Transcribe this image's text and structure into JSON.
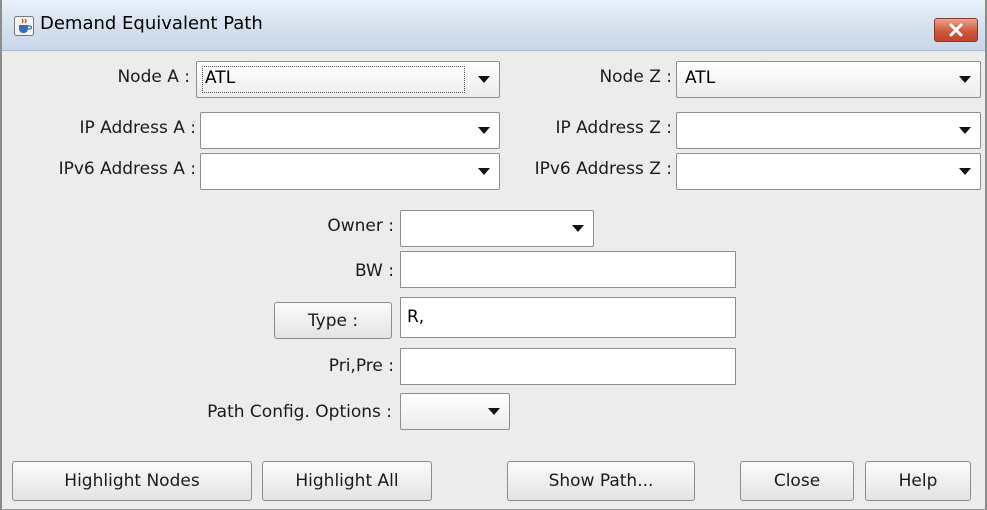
{
  "window": {
    "title": "Demand Equivalent Path",
    "icons": {
      "title": "java-cup-icon",
      "close": "close-icon"
    },
    "colors": {
      "close_button": "#c94a33",
      "titlebar": "#d3dfee",
      "body": "#ececec"
    }
  },
  "fields": {
    "node_a": {
      "label": "Node A :",
      "value": "ATL"
    },
    "node_z": {
      "label": "Node Z :",
      "value": "ATL"
    },
    "ip_a": {
      "label": "IP Address A :",
      "value": ""
    },
    "ip_z": {
      "label": "IP Address Z :",
      "value": ""
    },
    "ipv6_a": {
      "label": "IPv6 Address A :",
      "value": ""
    },
    "ipv6_z": {
      "label": "IPv6 Address Z :",
      "value": ""
    },
    "owner": {
      "label": "Owner :",
      "value": ""
    },
    "bw": {
      "label": "BW :",
      "value": ""
    },
    "type": {
      "label": "Type :",
      "value": "R,"
    },
    "pri_pre": {
      "label": "Pri,Pre :",
      "value": ""
    },
    "path_config": {
      "label": "Path Config. Options :",
      "value": ""
    }
  },
  "buttons": {
    "highlight_nodes": "Highlight Nodes",
    "highlight_all": "Highlight All",
    "show_path": "Show Path...",
    "close": "Close",
    "help": "Help"
  }
}
